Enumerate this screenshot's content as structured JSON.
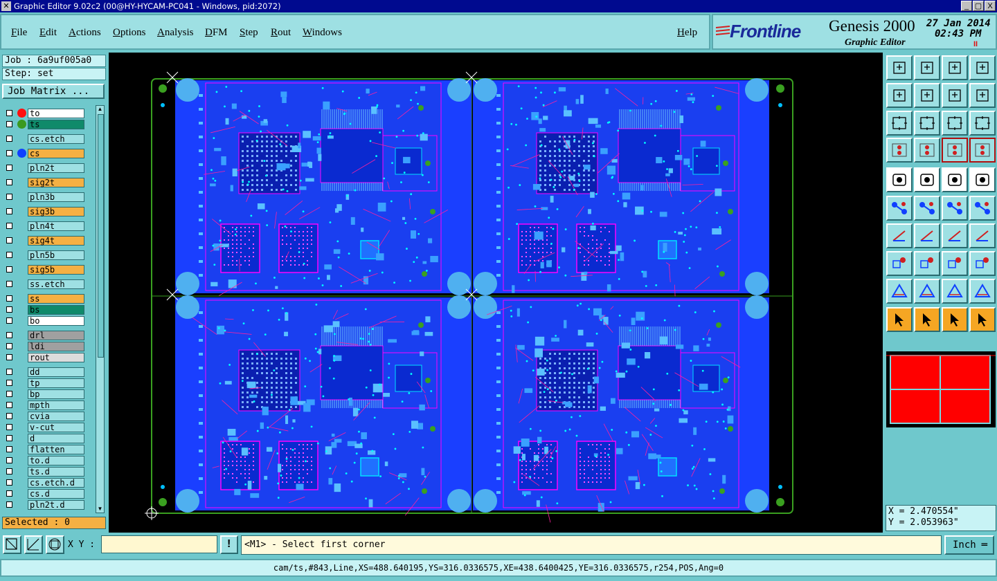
{
  "window": {
    "title": "Graphic Editor 9.02c2 (00@HY-HYCAM-PC041 - Windows, pid:2072)",
    "controls": [
      "_",
      "▢",
      "X"
    ]
  },
  "menu": {
    "items": [
      "File",
      "Edit",
      "Actions",
      "Options",
      "Analysis",
      "DFM",
      "Step",
      "Rout",
      "Windows"
    ],
    "help": "Help"
  },
  "brand": {
    "logo": "Frontline",
    "product": "Genesis 2000",
    "subtitle": "Graphic Editor",
    "date": "27 Jan 2014",
    "time": "02:43 PM",
    "pause": "II"
  },
  "left": {
    "job": "Job : 6a9uf005a0",
    "step": "Step: set",
    "job_matrix": "Job Matrix ...",
    "layers": [
      {
        "name": "to",
        "bg": "#ffffff",
        "dot": "#ff1010"
      },
      {
        "name": "ts",
        "bg": "#0f8a6a",
        "dot": "#3a9a20"
      },
      {
        "name": "cs.etch",
        "bg": "#9ee0e3",
        "dot": ""
      },
      {
        "name": "cs",
        "bg": "#f5b043",
        "dot": "#1040ff"
      },
      {
        "name": "pln2t",
        "bg": "#9ee0e3",
        "dot": ""
      },
      {
        "name": "sig2t",
        "bg": "#f5b043",
        "dot": ""
      },
      {
        "name": "pln3b",
        "bg": "#9ee0e3",
        "dot": ""
      },
      {
        "name": "sig3b",
        "bg": "#f5b043",
        "dot": ""
      },
      {
        "name": "pln4t",
        "bg": "#9ee0e3",
        "dot": ""
      },
      {
        "name": "sig4t",
        "bg": "#f5b043",
        "dot": ""
      },
      {
        "name": "pln5b",
        "bg": "#9ee0e3",
        "dot": ""
      },
      {
        "name": "sig5b",
        "bg": "#f5b043",
        "dot": ""
      },
      {
        "name": "ss.etch",
        "bg": "#9ee0e3",
        "dot": ""
      },
      {
        "name": "ss",
        "bg": "#f5b043",
        "dot": ""
      },
      {
        "name": "bs",
        "bg": "#0f8a6a",
        "dot": ""
      },
      {
        "name": "bo",
        "bg": "#ffffff",
        "dot": ""
      },
      {
        "name": "drl",
        "bg": "#a0a0a0",
        "dot": ""
      },
      {
        "name": "ldi",
        "bg": "#a0a0a0",
        "dot": ""
      },
      {
        "name": "rout",
        "bg": "#dcdcdc",
        "dot": ""
      },
      {
        "name": "dd",
        "bg": "#9ee0e3",
        "dot": ""
      },
      {
        "name": "tp",
        "bg": "#9ee0e3",
        "dot": ""
      },
      {
        "name": "bp",
        "bg": "#9ee0e3",
        "dot": ""
      },
      {
        "name": "mpth",
        "bg": "#9ee0e3",
        "dot": ""
      },
      {
        "name": "cvia",
        "bg": "#9ee0e3",
        "dot": ""
      },
      {
        "name": "v-cut",
        "bg": "#9ee0e3",
        "dot": ""
      },
      {
        "name": "d",
        "bg": "#9ee0e3",
        "dot": ""
      },
      {
        "name": "flatten",
        "bg": "#9ee0e3",
        "dot": ""
      },
      {
        "name": "to.d",
        "bg": "#9ee0e3",
        "dot": ""
      },
      {
        "name": "ts.d",
        "bg": "#9ee0e3",
        "dot": ""
      },
      {
        "name": "cs.etch.d",
        "bg": "#9ee0e3",
        "dot": ""
      },
      {
        "name": "cs.d",
        "bg": "#9ee0e3",
        "dot": ""
      },
      {
        "name": "pln2t.d",
        "bg": "#9ee0e3",
        "dot": ""
      }
    ],
    "selected": "Selected : 0"
  },
  "coords": {
    "x": "X = 2.470554\"",
    "y": "Y = 2.053963\""
  },
  "bottom": {
    "xy_label": "X Y :",
    "xy_value": "",
    "prompt": "<M1> - Select first corner",
    "unit": "Inch",
    "status": "cam/ts,#843,Line,XS=488.640195,YS=316.0336575,XE=438.6400425,YE=316.0336575,r254,POS,Ang=0"
  },
  "colors": {
    "panel": "#6fc8cc",
    "panel_light": "#9ee0e3",
    "board_fill": "#1a3fff",
    "board_dark": "#0a1fb0",
    "silk": "#ff00ff",
    "pad": "#00e0ff",
    "highlight": "#f5b043"
  }
}
